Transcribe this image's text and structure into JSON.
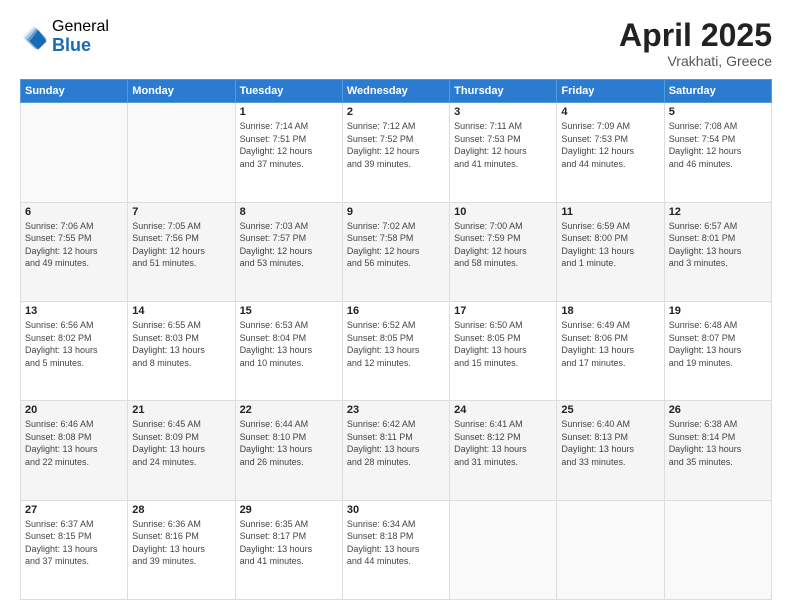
{
  "logo": {
    "general": "General",
    "blue": "Blue"
  },
  "header": {
    "month": "April 2025",
    "location": "Vrakhati, Greece"
  },
  "days_of_week": [
    "Sunday",
    "Monday",
    "Tuesday",
    "Wednesday",
    "Thursday",
    "Friday",
    "Saturday"
  ],
  "weeks": [
    [
      {
        "day": "",
        "info": ""
      },
      {
        "day": "",
        "info": ""
      },
      {
        "day": "1",
        "info": "Sunrise: 7:14 AM\nSunset: 7:51 PM\nDaylight: 12 hours\nand 37 minutes."
      },
      {
        "day": "2",
        "info": "Sunrise: 7:12 AM\nSunset: 7:52 PM\nDaylight: 12 hours\nand 39 minutes."
      },
      {
        "day": "3",
        "info": "Sunrise: 7:11 AM\nSunset: 7:53 PM\nDaylight: 12 hours\nand 41 minutes."
      },
      {
        "day": "4",
        "info": "Sunrise: 7:09 AM\nSunset: 7:53 PM\nDaylight: 12 hours\nand 44 minutes."
      },
      {
        "day": "5",
        "info": "Sunrise: 7:08 AM\nSunset: 7:54 PM\nDaylight: 12 hours\nand 46 minutes."
      }
    ],
    [
      {
        "day": "6",
        "info": "Sunrise: 7:06 AM\nSunset: 7:55 PM\nDaylight: 12 hours\nand 49 minutes."
      },
      {
        "day": "7",
        "info": "Sunrise: 7:05 AM\nSunset: 7:56 PM\nDaylight: 12 hours\nand 51 minutes."
      },
      {
        "day": "8",
        "info": "Sunrise: 7:03 AM\nSunset: 7:57 PM\nDaylight: 12 hours\nand 53 minutes."
      },
      {
        "day": "9",
        "info": "Sunrise: 7:02 AM\nSunset: 7:58 PM\nDaylight: 12 hours\nand 56 minutes."
      },
      {
        "day": "10",
        "info": "Sunrise: 7:00 AM\nSunset: 7:59 PM\nDaylight: 12 hours\nand 58 minutes."
      },
      {
        "day": "11",
        "info": "Sunrise: 6:59 AM\nSunset: 8:00 PM\nDaylight: 13 hours\nand 1 minute."
      },
      {
        "day": "12",
        "info": "Sunrise: 6:57 AM\nSunset: 8:01 PM\nDaylight: 13 hours\nand 3 minutes."
      }
    ],
    [
      {
        "day": "13",
        "info": "Sunrise: 6:56 AM\nSunset: 8:02 PM\nDaylight: 13 hours\nand 5 minutes."
      },
      {
        "day": "14",
        "info": "Sunrise: 6:55 AM\nSunset: 8:03 PM\nDaylight: 13 hours\nand 8 minutes."
      },
      {
        "day": "15",
        "info": "Sunrise: 6:53 AM\nSunset: 8:04 PM\nDaylight: 13 hours\nand 10 minutes."
      },
      {
        "day": "16",
        "info": "Sunrise: 6:52 AM\nSunset: 8:05 PM\nDaylight: 13 hours\nand 12 minutes."
      },
      {
        "day": "17",
        "info": "Sunrise: 6:50 AM\nSunset: 8:05 PM\nDaylight: 13 hours\nand 15 minutes."
      },
      {
        "day": "18",
        "info": "Sunrise: 6:49 AM\nSunset: 8:06 PM\nDaylight: 13 hours\nand 17 minutes."
      },
      {
        "day": "19",
        "info": "Sunrise: 6:48 AM\nSunset: 8:07 PM\nDaylight: 13 hours\nand 19 minutes."
      }
    ],
    [
      {
        "day": "20",
        "info": "Sunrise: 6:46 AM\nSunset: 8:08 PM\nDaylight: 13 hours\nand 22 minutes."
      },
      {
        "day": "21",
        "info": "Sunrise: 6:45 AM\nSunset: 8:09 PM\nDaylight: 13 hours\nand 24 minutes."
      },
      {
        "day": "22",
        "info": "Sunrise: 6:44 AM\nSunset: 8:10 PM\nDaylight: 13 hours\nand 26 minutes."
      },
      {
        "day": "23",
        "info": "Sunrise: 6:42 AM\nSunset: 8:11 PM\nDaylight: 13 hours\nand 28 minutes."
      },
      {
        "day": "24",
        "info": "Sunrise: 6:41 AM\nSunset: 8:12 PM\nDaylight: 13 hours\nand 31 minutes."
      },
      {
        "day": "25",
        "info": "Sunrise: 6:40 AM\nSunset: 8:13 PM\nDaylight: 13 hours\nand 33 minutes."
      },
      {
        "day": "26",
        "info": "Sunrise: 6:38 AM\nSunset: 8:14 PM\nDaylight: 13 hours\nand 35 minutes."
      }
    ],
    [
      {
        "day": "27",
        "info": "Sunrise: 6:37 AM\nSunset: 8:15 PM\nDaylight: 13 hours\nand 37 minutes."
      },
      {
        "day": "28",
        "info": "Sunrise: 6:36 AM\nSunset: 8:16 PM\nDaylight: 13 hours\nand 39 minutes."
      },
      {
        "day": "29",
        "info": "Sunrise: 6:35 AM\nSunset: 8:17 PM\nDaylight: 13 hours\nand 41 minutes."
      },
      {
        "day": "30",
        "info": "Sunrise: 6:34 AM\nSunset: 8:18 PM\nDaylight: 13 hours\nand 44 minutes."
      },
      {
        "day": "",
        "info": ""
      },
      {
        "day": "",
        "info": ""
      },
      {
        "day": "",
        "info": ""
      }
    ]
  ]
}
